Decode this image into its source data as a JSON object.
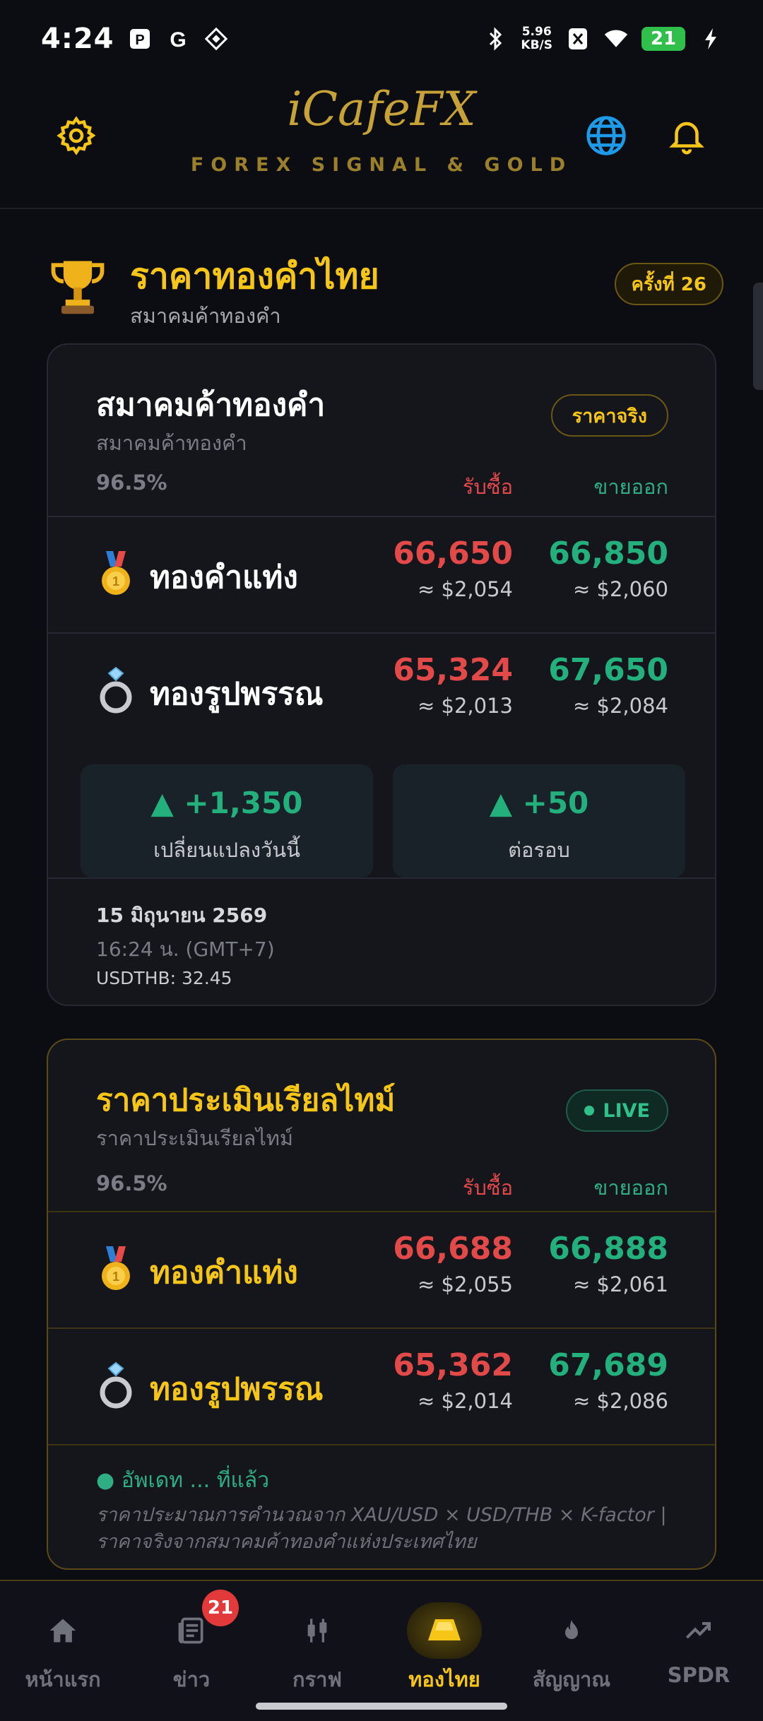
{
  "status_bar": {
    "time": "4:24",
    "network_speed_value": "5.96",
    "network_speed_unit": "KB/S",
    "battery": "21",
    "icons": [
      "p-app-icon",
      "google-icon",
      "diamond-app-icon",
      "bluetooth-icon",
      "x-app-icon",
      "wifi-icon",
      "charging-icon"
    ]
  },
  "header": {
    "logo_script": "iCafeFX",
    "logo_subtitle": "FOREX SIGNAL & GOLD",
    "settings_icon": "gear-icon",
    "language_icon": "globe-icon",
    "notification_icon": "bell-icon",
    "accent_color": "#f5c518"
  },
  "section": {
    "title": "ราคาทองคำไทย",
    "subtitle": "สมาคมค้าทองคำ",
    "round_badge": "ครั้งที่ 26"
  },
  "official_card": {
    "title": "สมาคมค้าทองคำ",
    "subtitle": "สมาคมค้าทองคำ",
    "pill": "ราคาจริง",
    "purity": "96.5%",
    "buy_header": "รับซื้อ",
    "sell_header": "ขายออก",
    "rows": [
      {
        "label": "ทองคำแท่ง",
        "icon": "medal-icon",
        "buy": "66,650",
        "buy_usd": "≈ $2,054",
        "sell": "66,850",
        "sell_usd": "≈ $2,060"
      },
      {
        "label": "ทองรูปพรรณ",
        "icon": "ring-icon",
        "buy": "65,324",
        "buy_usd": "≈ $2,013",
        "sell": "67,650",
        "sell_usd": "≈ $2,084"
      }
    ],
    "changes": [
      {
        "value": "▲ +1,350",
        "label": "เปลี่ยนแปลงวันนี้"
      },
      {
        "value": "▲ +50",
        "label": "ต่อรอบ"
      }
    ],
    "date": "15 มิถุนายน 2569",
    "time": "16:24 น. (GMT+7)",
    "rate": "USDTHB: 32.45"
  },
  "realtime_card": {
    "title": "ราคาประเมินเรียลไทม์",
    "subtitle": "ราคาประเมินเรียลไทม์",
    "pill": "LIVE",
    "purity": "96.5%",
    "buy_header": "รับซื้อ",
    "sell_header": "ขายออก",
    "rows": [
      {
        "label": "ทองคำแท่ง",
        "icon": "medal-icon",
        "buy": "66,688",
        "buy_usd": "≈ $2,055",
        "sell": "66,888",
        "sell_usd": "≈ $2,061"
      },
      {
        "label": "ทองรูปพรรณ",
        "icon": "ring-icon",
        "buy": "65,362",
        "buy_usd": "≈ $2,014",
        "sell": "67,689",
        "sell_usd": "≈ $2,086"
      }
    ],
    "update_text": "● อัพเดท ... ที่แล้ว",
    "note": "ราคาประมาณการคำนวณจาก XAU/USD × USD/THB × K-factor | ราคาจริงจากสมาคมค้าทองคำแห่งประเทศไทย"
  },
  "bottom_nav": {
    "items": [
      {
        "label": "หน้าแรก",
        "icon": "home-icon"
      },
      {
        "label": "ข่าว",
        "icon": "news-icon",
        "badge": "21"
      },
      {
        "label": "กราฟ",
        "icon": "candlestick-icon"
      },
      {
        "label": "ทองไทย",
        "icon": "gold-bar-icon",
        "active": true
      },
      {
        "label": "สัญญาณ",
        "icon": "flame-icon"
      },
      {
        "label": "SPDR",
        "icon": "trend-icon"
      }
    ]
  }
}
